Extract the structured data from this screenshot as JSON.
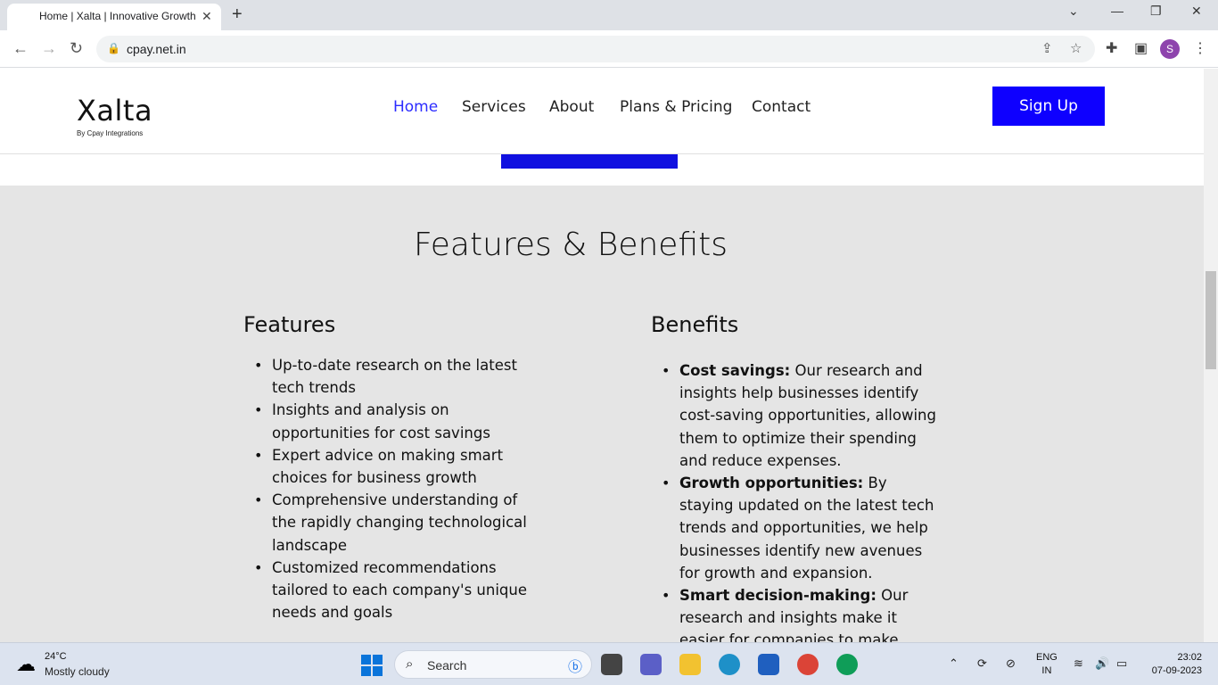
{
  "browser": {
    "tab_title": "Home | Xalta | Innovative Growth",
    "url": "cpay.net.in",
    "profile_initial": "S"
  },
  "site": {
    "logo": "Xalta",
    "logo_sub": "By Cpay Integrations",
    "nav": [
      "Home",
      "Services",
      "About",
      "Plans & Pricing",
      "Contact"
    ],
    "signup_label": "Sign Up"
  },
  "section": {
    "heading": "Features & Benefits",
    "features_title": "Features",
    "features": [
      "Up-to-date research on the latest tech trends",
      "Insights and analysis on opportunities for cost savings",
      "Expert advice on making smart choices for business growth",
      "Comprehensive understanding of the rapidly changing technological landscape",
      "Customized recommendations tailored to each company's unique needs and goals"
    ],
    "benefits_title": "Benefits",
    "benefits": [
      {
        "label": "Cost savings:",
        "text": " Our research and insights help businesses identify cost-saving opportunities, allowing them to optimize their spending and reduce expenses."
      },
      {
        "label": "Growth opportunities:",
        "text": " By staying updated on the latest tech trends and opportunities, we help businesses identify new avenues for growth and expansion."
      },
      {
        "label": "Smart decision-making:",
        "text": " Our research and insights make it easier for companies to make"
      }
    ]
  },
  "taskbar": {
    "temp": "24°C",
    "condition": "Mostly cloudy",
    "search_placeholder": "Search",
    "lang_1": "ENG",
    "lang_2": "IN",
    "time": "23:02",
    "date": "07-09-2023"
  },
  "colors": {
    "brand_blue": "#0e00ff",
    "section_bg": "#e5e5e5"
  }
}
